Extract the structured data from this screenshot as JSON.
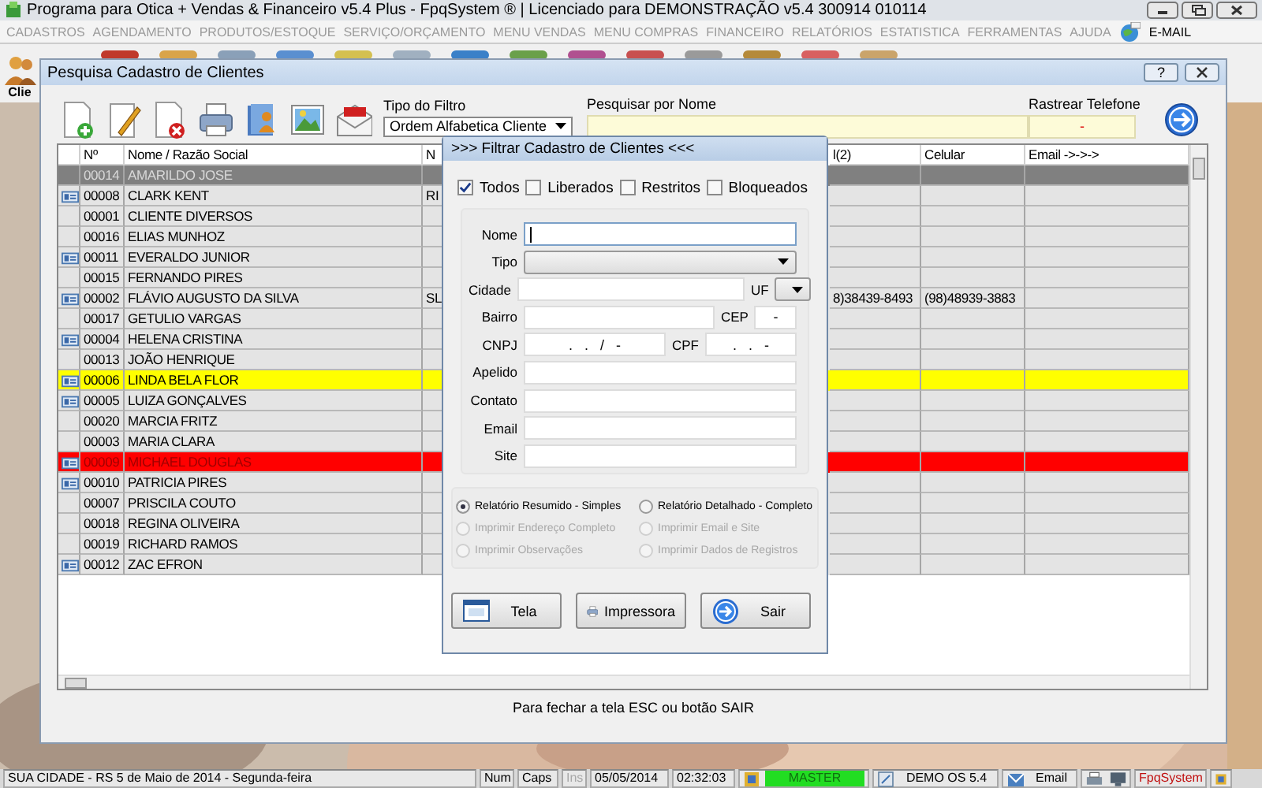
{
  "window": {
    "title": "Programa para Otica + Vendas & Financeiro v5.4 Plus - FpqSystem ® | Licenciado para  DEMONSTRAÇÃO v5.4 300914 010114"
  },
  "menu": [
    {
      "label": "CADASTROS",
      "disabled": true
    },
    {
      "label": "AGENDAMENTO",
      "disabled": true
    },
    {
      "label": "PRODUTOS/ESTOQUE",
      "disabled": true
    },
    {
      "label": "SERVIÇO/ORÇAMENTO",
      "disabled": true
    },
    {
      "label": "MENU VENDAS",
      "disabled": true
    },
    {
      "label": "MENU COMPRAS",
      "disabled": true
    },
    {
      "label": "FINANCEIRO",
      "disabled": true
    },
    {
      "label": "RELATÓRIOS",
      "disabled": true
    },
    {
      "label": "ESTATISTICA",
      "disabled": true
    },
    {
      "label": "FERRAMENTAS",
      "disabled": true
    },
    {
      "label": "AJUDA",
      "disabled": true
    },
    {
      "label": "E-MAIL",
      "disabled": false
    }
  ],
  "toolbar": {
    "first_button": "Clie"
  },
  "search_window": {
    "title": "Pesquisa Cadastro de Clientes",
    "help_button": "?",
    "filter": {
      "label": "Tipo do Filtro",
      "value": "Ordem Alfabetica Cliente"
    },
    "name_search": {
      "label": "Pesquisar por Nome"
    },
    "phone_search": {
      "label": "Rastrear Telefone",
      "value": "-"
    },
    "table": {
      "columns": [
        "Nº",
        "Nome / Razão Social",
        "N",
        "l(2)",
        "Celular",
        "Email ->->->"
      ],
      "rows": [
        {
          "card": false,
          "selected": true,
          "color": "#e4e4e4",
          "number": "00014",
          "name": "AMARILDO JOSE"
        },
        {
          "card": true,
          "selected": false,
          "color": "#e4e4e4",
          "number": "00008",
          "name": "CLARK KENT",
          "column_4": "RI"
        },
        {
          "card": false,
          "selected": false,
          "color": "#e4e4e4",
          "number": "00001",
          "name": "CLIENTE DIVERSOS"
        },
        {
          "card": false,
          "selected": false,
          "color": "#e4e4e4",
          "number": "00016",
          "name": "ELIAS MUNHOZ"
        },
        {
          "card": true,
          "selected": false,
          "color": "#e4e4e4",
          "number": "00011",
          "name": "EVERALDO JUNIOR"
        },
        {
          "card": false,
          "selected": false,
          "color": "#e4e4e4",
          "number": "00015",
          "name": "FERNANDO PIRES"
        },
        {
          "card": true,
          "selected": false,
          "color": "#e4e4e4",
          "number": "00002",
          "name": "FLÁVIO AUGUSTO DA SILVA",
          "column_4": "SL",
          "column_5": "8)38439-8493",
          "celular": "(98)48939-3883"
        },
        {
          "card": false,
          "selected": false,
          "color": "#e4e4e4",
          "number": "00017",
          "name": "GETULIO VARGAS"
        },
        {
          "card": true,
          "selected": false,
          "color": "#e4e4e4",
          "number": "00004",
          "name": "HELENA CRISTINA"
        },
        {
          "card": false,
          "selected": false,
          "color": "#e4e4e4",
          "number": "00013",
          "name": "JOÃO HENRIQUE"
        },
        {
          "card": true,
          "selected": false,
          "color": "#ffff00",
          "number": "00006",
          "name": "LINDA BELA FLOR"
        },
        {
          "card": true,
          "selected": false,
          "color": "#e4e4e4",
          "number": "00005",
          "name": "LUIZA GONÇALVES"
        },
        {
          "card": false,
          "selected": false,
          "color": "#e4e4e4",
          "number": "00020",
          "name": "MARCIA FRITZ"
        },
        {
          "card": false,
          "selected": false,
          "color": "#e4e4e4",
          "number": "00003",
          "name": "MARIA CLARA"
        },
        {
          "card": true,
          "selected": false,
          "color": "#ff0000",
          "number": "00009",
          "name": "MICHAEL DOUGLAS"
        },
        {
          "card": true,
          "selected": false,
          "color": "#e4e4e4",
          "number": "00010",
          "name": "PATRICIA PIRES"
        },
        {
          "card": false,
          "selected": false,
          "color": "#e4e4e4",
          "number": "00007",
          "name": "PRISCILA COUTO"
        },
        {
          "card": false,
          "selected": false,
          "color": "#e4e4e4",
          "number": "00018",
          "name": "REGINA OLIVEIRA"
        },
        {
          "card": false,
          "selected": false,
          "color": "#e4e4e4",
          "number": "00019",
          "name": "RICHARD RAMOS"
        },
        {
          "card": true,
          "selected": false,
          "color": "#e4e4e4",
          "number": "00012",
          "name": "ZAC EFRON"
        }
      ]
    },
    "footer": "Para fechar a tela ESC ou botão SAIR"
  },
  "filter_dialog": {
    "title": ">>> Filtrar Cadastro de Clientes <<<",
    "status_filters": [
      {
        "label": "Todos",
        "checked": true
      },
      {
        "label": "Liberados",
        "checked": false
      },
      {
        "label": "Restritos",
        "checked": false
      },
      {
        "label": "Bloqueados",
        "checked": false
      }
    ],
    "field_rows": [
      {
        "fields": [
          {
            "label": "Nome",
            "kind": "text",
            "focused": true
          }
        ]
      },
      {
        "fields": [
          {
            "label": "Tipo",
            "kind": "select"
          }
        ]
      },
      {
        "fields": [
          {
            "label": "Cidade",
            "kind": "text"
          },
          {
            "label": "UF",
            "kind": "select"
          }
        ]
      },
      {
        "fields": [
          {
            "label": "Bairro",
            "kind": "text"
          },
          {
            "label": "CEP",
            "kind": "text",
            "value": "-"
          }
        ]
      },
      {
        "fields": [
          {
            "label": "CNPJ",
            "kind": "text",
            "value": ".   .   /   -"
          },
          {
            "label": "CPF",
            "kind": "text",
            "value": ".   .   -"
          }
        ]
      },
      {
        "fields": [
          {
            "label": "Apelido",
            "kind": "text"
          }
        ]
      },
      {
        "fields": [
          {
            "label": "Contato",
            "kind": "text"
          }
        ]
      },
      {
        "fields": [
          {
            "label": "Email",
            "kind": "text"
          }
        ]
      },
      {
        "fields": [
          {
            "label": "Site",
            "kind": "text"
          }
        ]
      }
    ],
    "report_options": [
      {
        "label": "Relatório Resumido - Simples",
        "selected": true,
        "disabled": false
      },
      {
        "label": "Relatório Detalhado - Completo",
        "selected": false,
        "disabled": false
      },
      {
        "label": "Imprimir Endereço Completo",
        "selected": false,
        "disabled": true
      },
      {
        "label": "Imprimir Email e Site",
        "selected": false,
        "disabled": true
      },
      {
        "label": "Imprimir Observações",
        "selected": false,
        "disabled": true
      },
      {
        "label": "Imprimir Dados de Registros",
        "selected": false,
        "disabled": true
      }
    ],
    "buttons": [
      {
        "label": "Tela",
        "kind": "screen"
      },
      {
        "label": "Impressora",
        "kind": "printer"
      },
      {
        "label": "Sair",
        "kind": "exit"
      }
    ]
  },
  "status_bar": [
    {
      "kind": "text",
      "text": "SUA CIDADE - RS  5 de Maio de 2014 - Segunda-feira",
      "disabled": false
    },
    {
      "kind": "text",
      "text": "Num",
      "disabled": false
    },
    {
      "kind": "text",
      "text": "Caps",
      "disabled": false
    },
    {
      "kind": "text",
      "text": "Ins",
      "disabled": true
    },
    {
      "kind": "text",
      "text": "05/05/2014",
      "disabled": false
    },
    {
      "kind": "text",
      "text": "02:32:03",
      "disabled": false
    },
    {
      "kind": "user",
      "text": "MASTER",
      "disabled": false
    },
    {
      "kind": "version",
      "text": "DEMO OS 5.4",
      "disabled": false
    },
    {
      "kind": "email",
      "text": "Email",
      "disabled": false
    },
    {
      "kind": "tools",
      "disabled": false
    },
    {
      "kind": "brand",
      "text": "FpqSystem",
      "disabled": false
    },
    {
      "kind": "tool",
      "disabled": false
    }
  ]
}
